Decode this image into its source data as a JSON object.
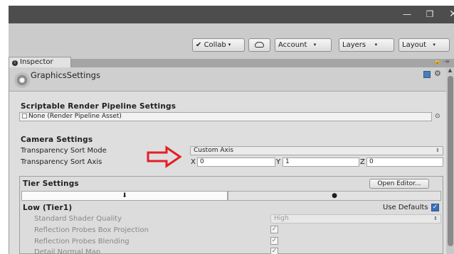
{
  "window": {
    "minimize_glyph": "—",
    "maximize_glyph": "❐",
    "close_glyph": "✕"
  },
  "toolbar": {
    "collab_label": "Collab",
    "account_label": "Account",
    "layers_label": "Layers",
    "layout_label": "Layout",
    "caret": "▾"
  },
  "tab": {
    "label": "Inspector",
    "right_icons": "🔒 -≡"
  },
  "header": {
    "title": "GraphicsSettings"
  },
  "srp": {
    "section_title": "Scriptable Render Pipeline Settings",
    "field_value": "None (Render Pipeline Asset)"
  },
  "camera": {
    "section_title": "Camera Settings",
    "sort_mode_label": "Transparency Sort Mode",
    "sort_mode_value": "Custom Axis",
    "sort_axis_label": "Transparency Sort Axis",
    "x_label": "X",
    "x_value": "0",
    "y_label": "Y",
    "y_value": "1",
    "z_label": "Z",
    "z_value": "0"
  },
  "tier": {
    "section_title": "Tier Settings",
    "open_editor_label": "Open Editor...",
    "platform_tab_1_icon": "⬇",
    "platform_tab_2_icon": "●",
    "low_title": "Low (Tier1)",
    "use_defaults_label": "Use Defaults",
    "rows": [
      {
        "label": "Standard Shader Quality",
        "value": "High"
      },
      {
        "label": "Reflection Probes Box Projection",
        "value": "✓"
      },
      {
        "label": "Reflection Probes Blending",
        "value": "✓"
      },
      {
        "label": "Detail Normal Map",
        "value": "✓"
      }
    ]
  },
  "colors": {
    "arrow": "#e41e26",
    "checkbox_on": "#3a6fb8"
  }
}
